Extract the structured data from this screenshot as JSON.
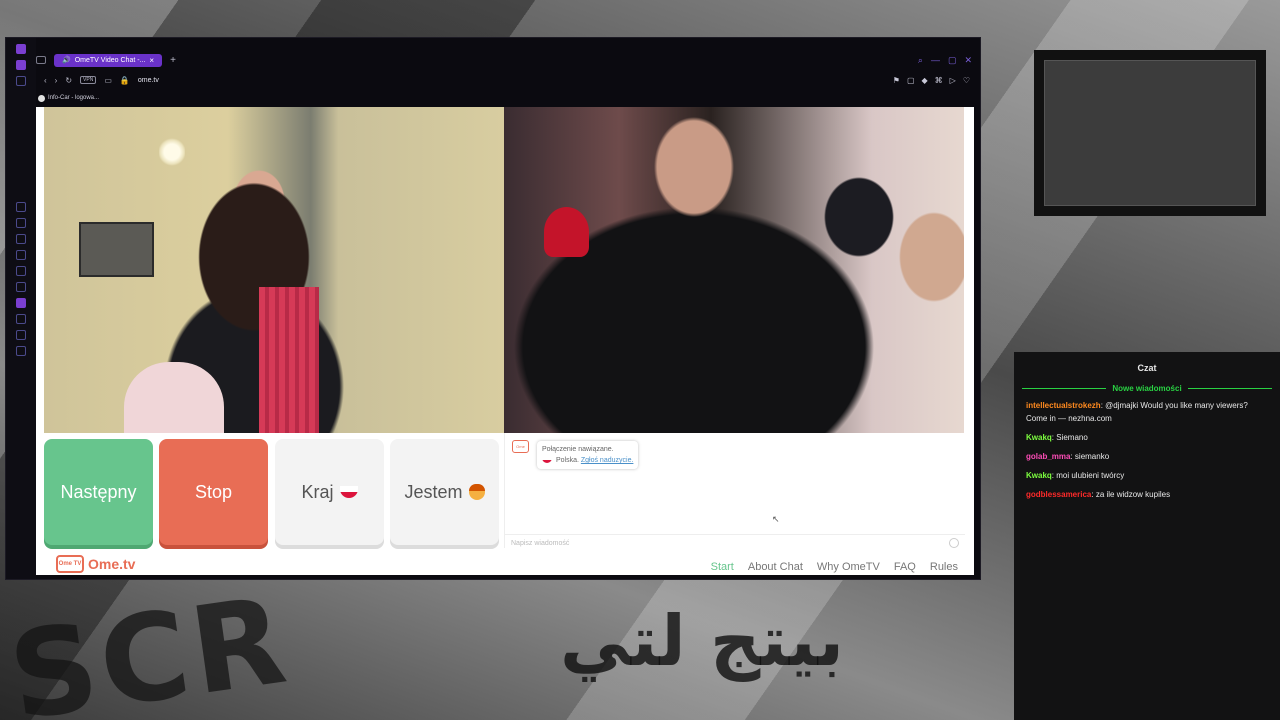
{
  "stream_background": {
    "overlay_text_left": "SCR",
    "overlay_text_right": "بيتج لتي"
  },
  "browser": {
    "tab_label": "OmeTV Video Chat -...",
    "tab_close": "×",
    "new_tab": "+",
    "url": "ome.tv",
    "vpn_label": "VPN",
    "bookmark_label": "Info-Car - logowa...",
    "window_controls": [
      "⌕",
      "—",
      "▢",
      "✕"
    ]
  },
  "ometv": {
    "buttons": {
      "next": "Następny",
      "stop": "Stop",
      "country": "Kraj",
      "gender": "Jestem"
    },
    "chat": {
      "logo_text": "Ome",
      "status_line1": "Połączenie nawiązane.",
      "status_country": "Polska.",
      "report_link": "Zgłoś naduzycie.",
      "input_placeholder": "Napisz wiadomość"
    },
    "footer": {
      "logo_badge": "Ome TV",
      "brand": "Ome.tv",
      "nav": [
        "Start",
        "About Chat",
        "Why OmeTV",
        "FAQ",
        "Rules"
      ]
    }
  },
  "stream_chat": {
    "title": "Czat",
    "new_messages_label": "Nowe wiadomości",
    "messages": [
      {
        "user": "intellectualstrokezh",
        "color": "#ff8a1f",
        "text": ": @djmajki Would you like many viewers? Come in — nezhna.com"
      },
      {
        "user": "Kwakq",
        "color": "#7dff3f",
        "text": ": Siemano"
      },
      {
        "user": "golab_mma",
        "color": "#ff4db8",
        "text": ": siemanko"
      },
      {
        "user": "Kwakq",
        "color": "#7dff3f",
        "text": ": moi ulubieni twórcy"
      },
      {
        "user": "godblessamerica",
        "color": "#ff2a2a",
        "text": ": za ile widzow kupiles"
      }
    ]
  },
  "colors": {
    "next_button": "#67c58d",
    "stop_button": "#e86d55",
    "accent_purple": "#6a32c9",
    "chat_new_green": "#29d143"
  }
}
